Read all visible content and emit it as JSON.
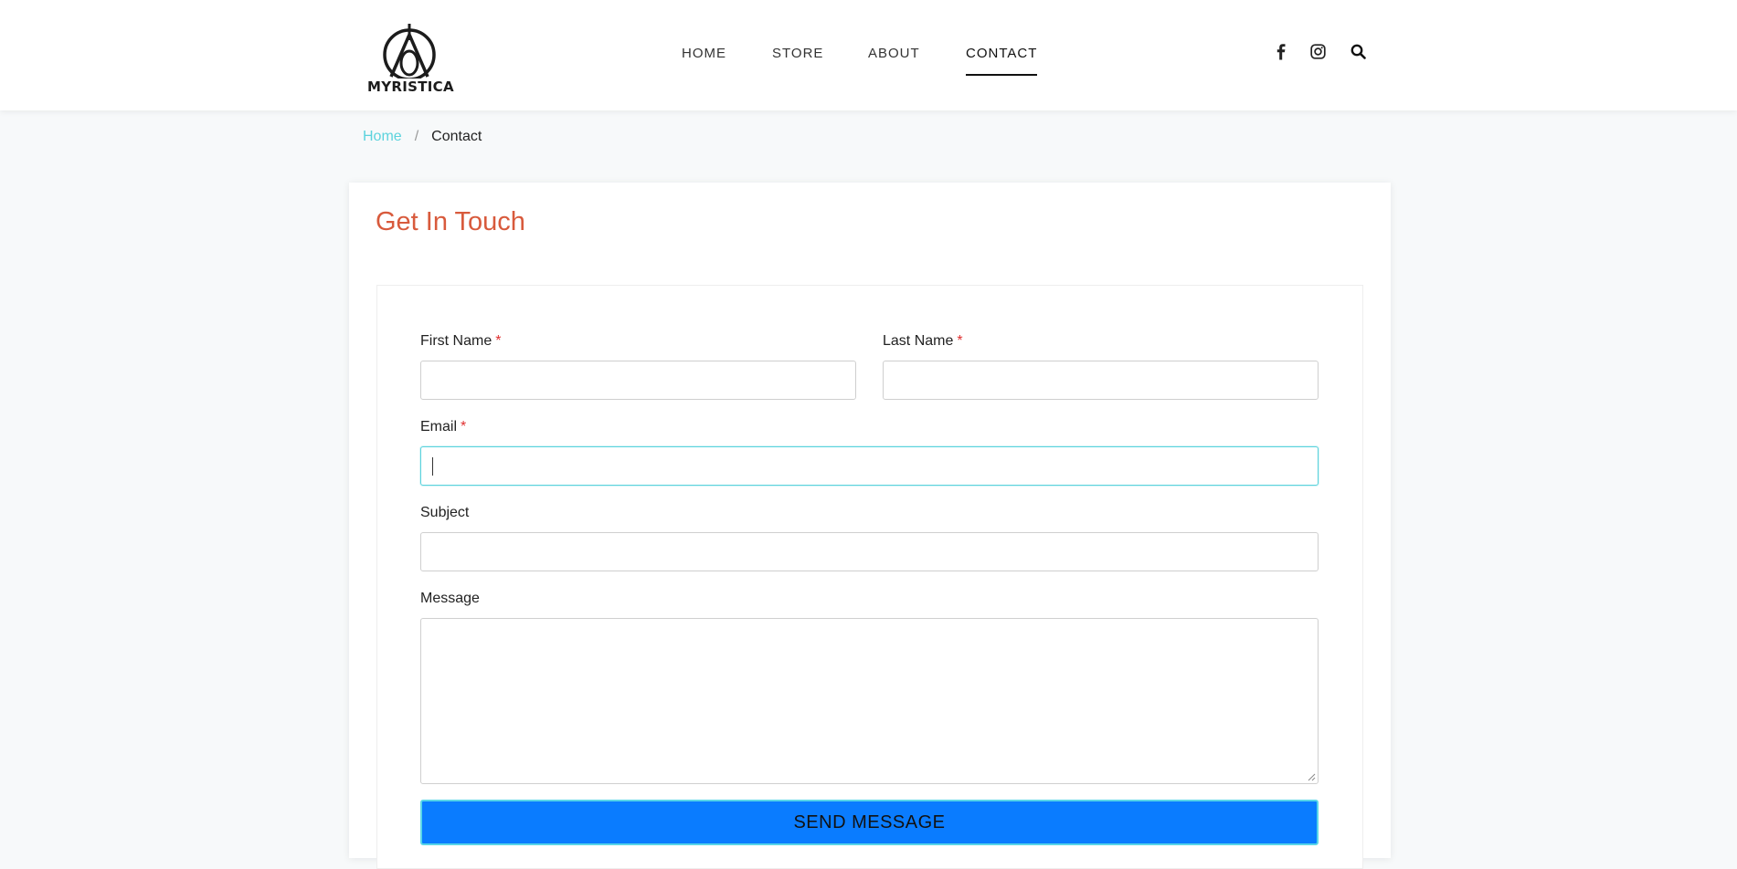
{
  "brand": {
    "name": "MYRISTICA",
    "logo_icon": "myristica-logo-icon"
  },
  "nav": {
    "items": [
      {
        "label": "HOME"
      },
      {
        "label": "STORE"
      },
      {
        "label": "ABOUT"
      },
      {
        "label": "CONTACT",
        "active": true
      }
    ]
  },
  "social": {
    "icons": [
      "facebook-icon",
      "instagram-icon",
      "search-icon"
    ]
  },
  "breadcrumb": {
    "home": "Home",
    "separator": "/",
    "current": "Contact"
  },
  "contact_form": {
    "title": "Get In Touch",
    "required_marker": "*",
    "fields": {
      "first_name": {
        "label": "First Name",
        "value": "",
        "required": true
      },
      "last_name": {
        "label": "Last Name",
        "value": "",
        "required": true
      },
      "email": {
        "label": "Email",
        "value": "",
        "required": true,
        "focused": true
      },
      "subject": {
        "label": "Subject",
        "value": ""
      },
      "message": {
        "label": "Message",
        "value": ""
      }
    },
    "submit_label": "SEND MESSAGE"
  },
  "colors": {
    "accent_link": "#5cd3dd",
    "title": "#d85a3c",
    "button": "#0a7cff",
    "required": "#e03030"
  }
}
